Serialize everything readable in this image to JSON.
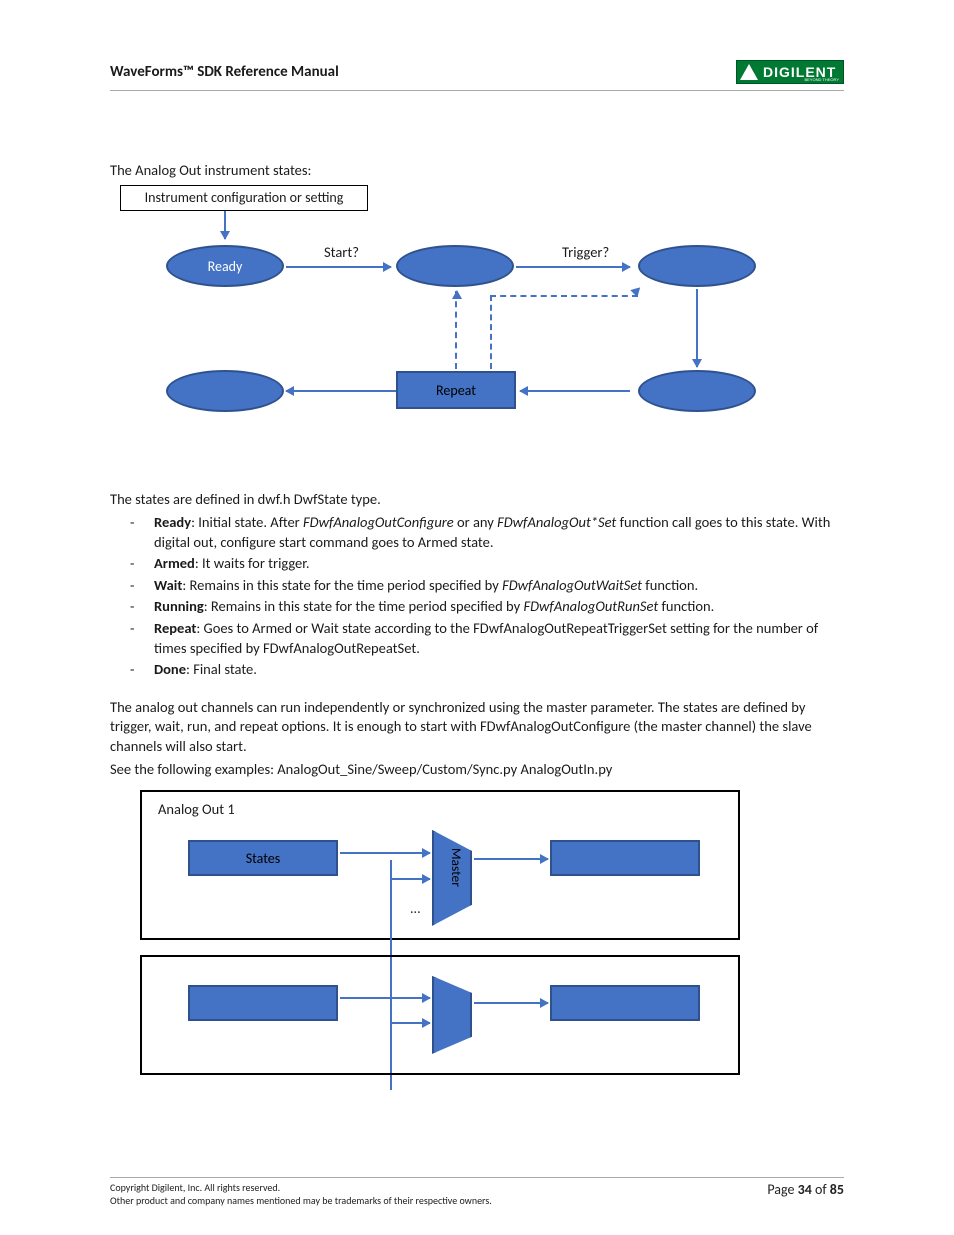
{
  "header": {
    "title": "WaveForms™ SDK Reference Manual",
    "logo_text": "DIGILENT",
    "logo_sub": "BEYOND THEORY"
  },
  "intro": "The Analog Out instrument states:",
  "diagram1": {
    "config_box": "Instrument configuration or setting",
    "ready": "Ready",
    "start_q": "Start?",
    "trigger_q": "Trigger?",
    "repeat": "Repeat"
  },
  "states_line": "The states are defined in dwf.h DwfState type.",
  "bullets": [
    {
      "name": "Ready",
      "text": ": Initial state. After ",
      "ital1": "FDwfAnalogOutConfigure",
      "mid": " or any ",
      "ital2": "FDwfAnalogOut*Set",
      "tail": " function call goes to this state. With digital out, configure start command goes to Armed state."
    },
    {
      "name": "Armed",
      "text": ": It waits for trigger."
    },
    {
      "name": "Wait",
      "text": ": Remains in this state for the time period specified by ",
      "ital1": "FDwfAnalogOutWaitSet",
      "tail": " function."
    },
    {
      "name": "Running",
      "text": ": Remains in this state for the time period specified by ",
      "ital1": "FDwfAnalogOutRunSet",
      "tail": " function."
    },
    {
      "name": "Repeat",
      "text": ": Goes to Armed or Wait state according to the FDwfAnalogOutRepeatTriggerSet setting for the number of times specified by FDwfAnalogOutRepeatSet."
    },
    {
      "name": "Done",
      "text": ": Final state."
    }
  ],
  "para2": "The analog out channels can run independently or synchronized using the master parameter. The states are defined by trigger, wait, run, and repeat options. It is enough to start with FDwfAnalogOutConfigure (the master channel) the slave channels will also start.",
  "para3": "See the following examples: AnalogOut_Sine/Sweep/Custom/Sync.py AnalogOutIn.py",
  "diagram2": {
    "title": "Analog Out 1",
    "states": "States",
    "master": "Master",
    "dots": "..."
  },
  "footer": {
    "l1": "Copyright Digilent, Inc. All rights reserved.",
    "l2": "Other product and company names mentioned may be trademarks of their respective owners.",
    "page_prefix": "Page ",
    "page_cur": "34",
    "page_of": " of ",
    "page_tot": "85"
  }
}
